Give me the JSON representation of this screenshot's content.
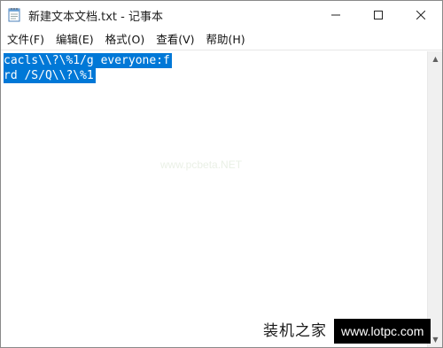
{
  "window": {
    "title": "新建文本文档.txt - 记事本",
    "app_icon": "notepad-icon",
    "controls": {
      "minimize_icon": "minimize-icon",
      "maximize_icon": "maximize-icon",
      "close_icon": "close-icon"
    }
  },
  "menu": {
    "items": [
      {
        "label": "文件(F)"
      },
      {
        "label": "编辑(E)"
      },
      {
        "label": "格式(O)"
      },
      {
        "label": "查看(V)"
      },
      {
        "label": "帮助(H)"
      }
    ]
  },
  "editor": {
    "lines": [
      "cacls\\\\?\\%1/g everyone:f",
      "rd /S/Q\\\\?\\%1"
    ],
    "selection_color": "#0078d7",
    "center_watermark": "www.pcbeta.NET"
  },
  "watermark": {
    "site_name": "装机之家",
    "site_url": "www.lotpc.com"
  }
}
